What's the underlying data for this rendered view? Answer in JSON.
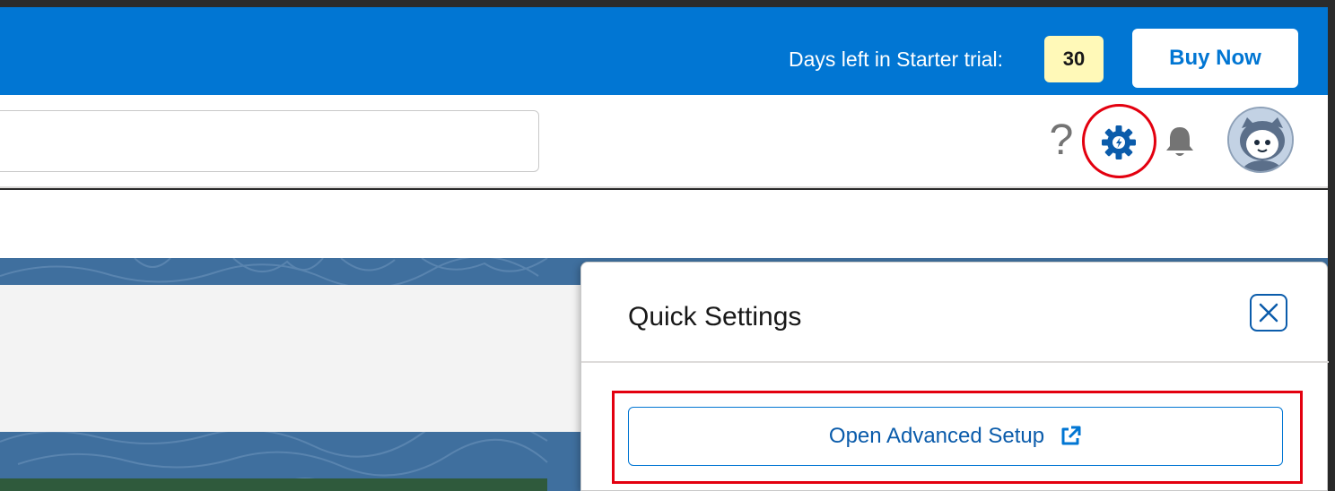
{
  "trial_banner": {
    "days_left_label": "Days left in Starter trial:",
    "days_left_count": "30",
    "buy_now_label": "Buy Now"
  },
  "header": {
    "search_value": "",
    "help_icon": "question-icon",
    "setup_icon": "gear-icon",
    "notifications_icon": "bell-icon",
    "avatar_icon": "astro-avatar"
  },
  "quick_settings": {
    "title": "Quick Settings",
    "close_icon": "close-icon",
    "open_advanced_setup_label": "Open Advanced Setup",
    "external_link_icon": "external-link-icon"
  },
  "colors": {
    "brand_blue": "#0176d3",
    "trial_badge": "#fff9b8",
    "highlight_red": "#e3000f"
  }
}
